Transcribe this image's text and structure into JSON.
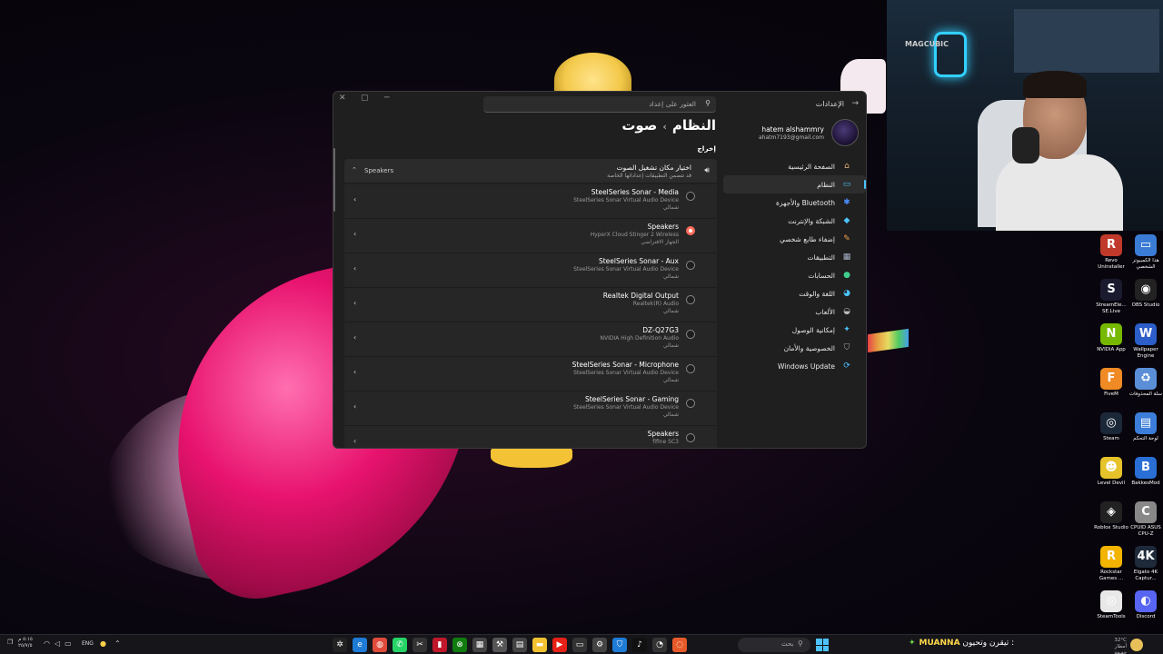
{
  "window": {
    "app_title": "الإعدادات",
    "search_placeholder": "العثور على إعداد",
    "breadcrumb_parent": "النظام",
    "breadcrumb_separator": "›",
    "breadcrumb_current": "صوت",
    "section_label": "إخراج"
  },
  "profile": {
    "name": "hatem alshammry",
    "email": "ahatm7193@gmail.com"
  },
  "nav": {
    "items": [
      {
        "label": "الصفحة الرئيسية",
        "icon": "home-icon",
        "glyph": "⌂",
        "color": "#e6b07a",
        "active": false
      },
      {
        "label": "النظام",
        "icon": "system-icon",
        "glyph": "▭",
        "color": "#4cc2ff",
        "active": true
      },
      {
        "label": "Bluetooth والأجهزة",
        "icon": "bluetooth-icon",
        "glyph": "✱",
        "color": "#4c8dff",
        "active": false
      },
      {
        "label": "الشبكة والإنترنت",
        "icon": "network-icon",
        "glyph": "◆",
        "color": "#4cc2ff",
        "active": false
      },
      {
        "label": "إضفاء طابع شخصي",
        "icon": "brush-icon",
        "glyph": "✎",
        "color": "#f0a050",
        "active": false
      },
      {
        "label": "التطبيقات",
        "icon": "apps-icon",
        "glyph": "▦",
        "color": "#aab4c8",
        "active": false
      },
      {
        "label": "الحسابات",
        "icon": "account-icon",
        "glyph": "●",
        "color": "#3fcf8e",
        "active": false
      },
      {
        "label": "اللغة والوقت",
        "icon": "globe-clock-icon",
        "glyph": "◕",
        "color": "#4cc2ff",
        "active": false
      },
      {
        "label": "الألعاب",
        "icon": "gamepad-icon",
        "glyph": "◒",
        "color": "#bbbbbb",
        "active": false
      },
      {
        "label": "إمكانية الوصول",
        "icon": "accessibility-icon",
        "glyph": "✦",
        "color": "#4cc2ff",
        "active": false
      },
      {
        "label": "الخصوصية والأمان",
        "icon": "shield-icon",
        "glyph": "⛉",
        "color": "#aaaaaa",
        "active": false
      },
      {
        "label": "Windows Update",
        "icon": "windows-update-icon",
        "glyph": "⟳",
        "color": "#4cc2ff",
        "active": false
      }
    ]
  },
  "output_card": {
    "title": "اختيار مكان تشغيل الصوت",
    "subtitle": "قد تتضمن التطبيقات إعداداتها الخاصة",
    "selected_value": "Speakers",
    "collapse_glyph": "⌃"
  },
  "devices": [
    {
      "name": "SteelSeries Sonar - Media",
      "driver": "SteelSeries Sonar Virtual Audio Device",
      "status": "شمالي",
      "checked": false
    },
    {
      "name": "Speakers",
      "driver": "HyperX Cloud Stinger 2 Wireless",
      "status": "الجهاز الافتراضي",
      "checked": true
    },
    {
      "name": "SteelSeries Sonar - Aux",
      "driver": "SteelSeries Sonar Virtual Audio Device",
      "status": "شمالي",
      "checked": false
    },
    {
      "name": "Realtek Digital Output",
      "driver": "Realtek(R) Audio",
      "status": "شمالي",
      "checked": false
    },
    {
      "name": "DZ-Q27G3",
      "driver": "NVIDIA High Definition Audio",
      "status": "شمالي",
      "checked": false
    },
    {
      "name": "SteelSeries Sonar - Microphone",
      "driver": "SteelSeries Sonar Virtual Audio Device",
      "status": "شمالي",
      "checked": false
    },
    {
      "name": "SteelSeries Sonar - Gaming",
      "driver": "SteelSeries Sonar Virtual Audio Device",
      "status": "شمالي",
      "checked": false
    },
    {
      "name": "Speakers",
      "driver": "fifine SC3",
      "status": "",
      "checked": false
    }
  ],
  "webcam": {
    "brand": "MAGCUBIC"
  },
  "desktop_icons": [
    {
      "label": "Revo Uninstaller",
      "icon": "revo-icon",
      "glyph": "R",
      "bg": "#c0392b"
    },
    {
      "label": "هذا الكمبيوتر الشخصي",
      "icon": "this-pc-icon",
      "glyph": "▭",
      "bg": "#3a7bd5"
    },
    {
      "label": "StreamEle... SE.Live",
      "icon": "streamelements-icon",
      "glyph": "S",
      "bg": "#1b1b2f"
    },
    {
      "label": "OBS Studio",
      "icon": "obs-icon",
      "glyph": "◉",
      "bg": "#222"
    },
    {
      "label": "NVIDIA App",
      "icon": "nvidia-icon",
      "glyph": "N",
      "bg": "#76b900"
    },
    {
      "label": "Wallpaper Engine",
      "icon": "wallpaper-engine-icon",
      "glyph": "W",
      "bg": "#2b5ec9"
    },
    {
      "label": "FiveM",
      "icon": "fivem-icon",
      "glyph": "F",
      "bg": "#f08a24"
    },
    {
      "label": "سلة المحذوفات",
      "icon": "recycle-bin-icon",
      "glyph": "♻",
      "bg": "#5a8fd8"
    },
    {
      "label": "Steam",
      "icon": "steam-icon",
      "glyph": "◎",
      "bg": "#1b2838"
    },
    {
      "label": "لوحة التحكم",
      "icon": "control-panel-icon",
      "glyph": "▤",
      "bg": "#3b7dd8"
    },
    {
      "label": "Level Devil",
      "icon": "level-devil-icon",
      "glyph": "☻",
      "bg": "#e6c32a"
    },
    {
      "label": "BakkesMod",
      "icon": "bakkesmod-icon",
      "glyph": "B",
      "bg": "#2a6fd6"
    },
    {
      "label": "Roblox Studio",
      "icon": "roblox-studio-icon",
      "glyph": "◈",
      "bg": "#222"
    },
    {
      "label": "CPUID ASUS CPU-Z",
      "icon": "cpuz-icon",
      "glyph": "C",
      "bg": "#888"
    },
    {
      "label": "Rockstar Games ...",
      "icon": "rockstar-icon",
      "glyph": "R",
      "bg": "#f3b400"
    },
    {
      "label": "Elgato 4K Captur...",
      "icon": "elgato-icon",
      "glyph": "4K",
      "bg": "#1e2a3a"
    },
    {
      "label": "SteamTools",
      "icon": "steamtools-icon",
      "glyph": "◎",
      "bg": "#e8e8e8"
    },
    {
      "label": "Discord",
      "icon": "discord-icon",
      "glyph": "◐",
      "bg": "#5865f2"
    }
  ],
  "taskbar": {
    "search_text": "بحث",
    "ticker_prefix": "تيقرن وتحيون :",
    "ticker_brand": "MUANNA",
    "weather_temp": "32°C",
    "weather_desc": "أمطار خفيفة",
    "lang": "ENG",
    "time": "٥:١٥ م",
    "date": "٢٥/٧/٥",
    "apps": [
      {
        "icon": "chatgpt-icon",
        "glyph": "✲",
        "bg": "#222"
      },
      {
        "icon": "edge-icon",
        "glyph": "e",
        "bg": "#1e7bd6"
      },
      {
        "icon": "chrome-icon",
        "glyph": "◍",
        "bg": "#e04a3a"
      },
      {
        "icon": "whatsapp-icon",
        "glyph": "✆",
        "bg": "#25d366"
      },
      {
        "icon": "capcut-icon",
        "glyph": "✂",
        "bg": "#333"
      },
      {
        "icon": "app-red-icon",
        "glyph": "▮",
        "bg": "#c0182a"
      },
      {
        "icon": "xbox-icon",
        "glyph": "⊗",
        "bg": "#107c10"
      },
      {
        "icon": "calculator-icon",
        "glyph": "▦",
        "bg": "#444"
      },
      {
        "icon": "tools-icon",
        "glyph": "⚒",
        "bg": "#555"
      },
      {
        "icon": "calendar-icon",
        "glyph": "▤",
        "bg": "#444"
      },
      {
        "icon": "file-explorer-icon",
        "glyph": "▬",
        "bg": "#f2c230"
      },
      {
        "icon": "youtube-icon",
        "glyph": "▶",
        "bg": "#e62117"
      },
      {
        "icon": "task-manager-icon",
        "glyph": "▭",
        "bg": "#333"
      },
      {
        "icon": "settings-icon",
        "glyph": "⚙",
        "bg": "#444"
      },
      {
        "icon": "defender-icon",
        "glyph": "⛉",
        "bg": "#1e7bd6"
      },
      {
        "icon": "tiktok-icon",
        "glyph": "♪",
        "bg": "#111"
      },
      {
        "icon": "davinci-icon",
        "glyph": "◔",
        "bg": "#333"
      },
      {
        "icon": "steelseries-icon",
        "glyph": "◌",
        "bg": "#e65a2a"
      }
    ]
  }
}
